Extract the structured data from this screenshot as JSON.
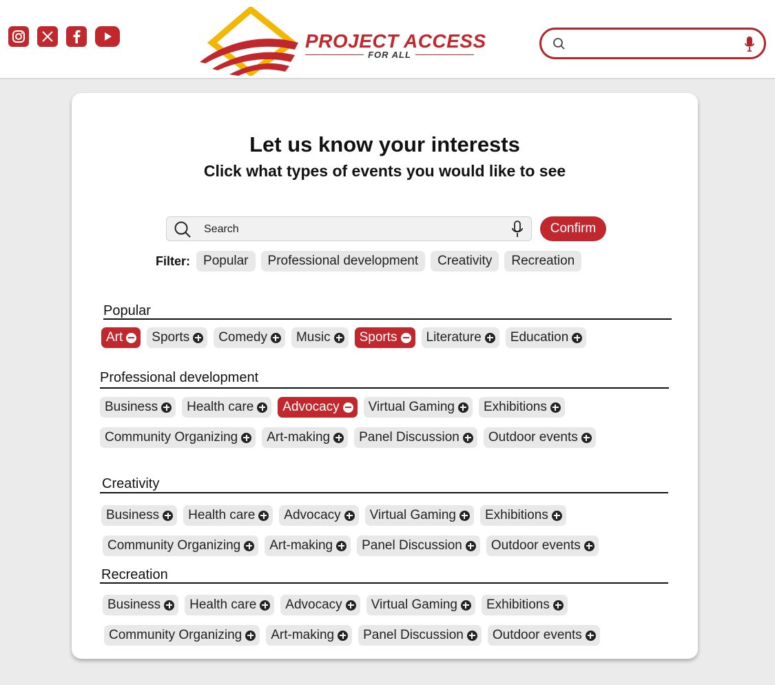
{
  "header": {
    "logo_main": "PROJECT ACCESS",
    "logo_sub": "FOR ALL",
    "socials": [
      "instagram-icon",
      "x-icon",
      "facebook-icon",
      "youtube-icon"
    ]
  },
  "card": {
    "title": "Let us know your interests",
    "subtitle": "Click what types of events you would like to see",
    "search_placeholder": "Search",
    "confirm_label": "Confirm",
    "filter_label": "Filter:",
    "filters": [
      "Popular",
      "Professional development",
      "Creativity",
      "Recreation"
    ]
  },
  "sections": [
    {
      "title": "Popular",
      "rows": [
        [
          {
            "label": "Art",
            "selected": true
          },
          {
            "label": "Sports",
            "selected": false
          },
          {
            "label": "Comedy",
            "selected": false
          },
          {
            "label": "Music",
            "selected": false
          },
          {
            "label": "Sports",
            "selected": true
          },
          {
            "label": "Literature",
            "selected": false
          },
          {
            "label": "Education",
            "selected": false
          }
        ]
      ]
    },
    {
      "title": "Professional development",
      "rows": [
        [
          {
            "label": "Business",
            "selected": false
          },
          {
            "label": "Health care",
            "selected": false
          },
          {
            "label": "Advocacy",
            "selected": true
          },
          {
            "label": "Virtual Gaming",
            "selected": false
          },
          {
            "label": "Exhibitions",
            "selected": false
          }
        ],
        [
          {
            "label": "Community Organizing",
            "selected": false
          },
          {
            "label": "Art-making",
            "selected": false
          },
          {
            "label": "Panel Discussion",
            "selected": false
          },
          {
            "label": "Outdoor events",
            "selected": false
          }
        ]
      ]
    },
    {
      "title": "Creativity",
      "rows": [
        [
          {
            "label": "Business",
            "selected": false
          },
          {
            "label": "Health care",
            "selected": false
          },
          {
            "label": "Advocacy",
            "selected": false
          },
          {
            "label": "Virtual Gaming",
            "selected": false
          },
          {
            "label": "Exhibitions",
            "selected": false
          }
        ],
        [
          {
            "label": "Community Organizing",
            "selected": false
          },
          {
            "label": "Art-making",
            "selected": false
          },
          {
            "label": "Panel Discussion",
            "selected": false
          },
          {
            "label": "Outdoor events",
            "selected": false
          }
        ]
      ]
    },
    {
      "title": "Recreation",
      "rows": [
        [
          {
            "label": "Business",
            "selected": false
          },
          {
            "label": "Health care",
            "selected": false
          },
          {
            "label": "Advocacy",
            "selected": false
          },
          {
            "label": "Virtual Gaming",
            "selected": false
          },
          {
            "label": "Exhibitions",
            "selected": false
          }
        ],
        [
          {
            "label": "Community Organizing",
            "selected": false
          },
          {
            "label": "Art-making",
            "selected": false
          },
          {
            "label": "Panel Discussion",
            "selected": false
          },
          {
            "label": "Outdoor events",
            "selected": false
          }
        ]
      ]
    }
  ],
  "colors": {
    "accent": "#c0282d",
    "logo_gold": "#f2b705",
    "chip_bg": "#e8e8e8",
    "page_bg": "#ebebeb"
  }
}
